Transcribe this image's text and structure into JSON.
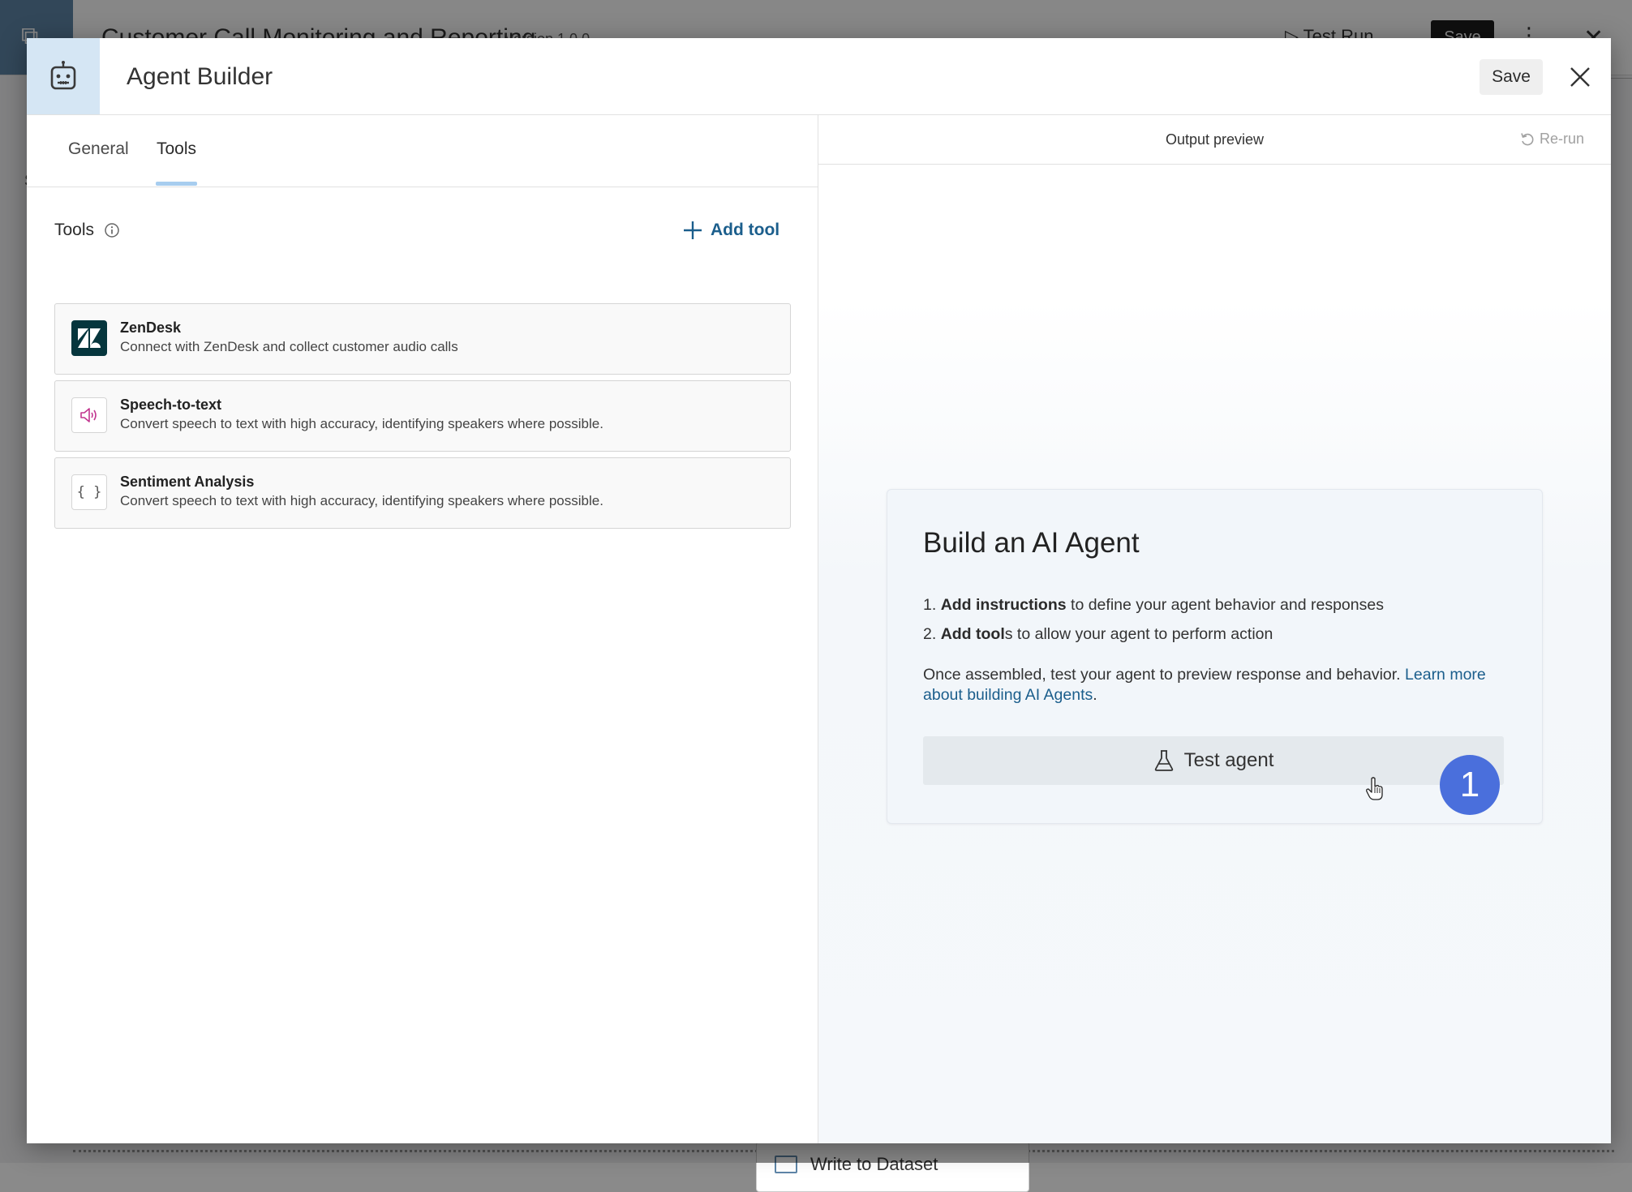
{
  "background_app": {
    "title": "Customer Call Monitoring and Reporting",
    "version": "Version 1.0.0",
    "test_run_label": "Test Run",
    "save_label": "Save",
    "side_letter": "S",
    "dataset_node_label": "Write to Dataset"
  },
  "modal": {
    "title": "Agent Builder",
    "save_label": "Save"
  },
  "tabs": [
    {
      "label": "General",
      "active": false
    },
    {
      "label": "Tools",
      "active": true
    }
  ],
  "tools": {
    "heading": "Tools",
    "add_label": "Add tool",
    "items": [
      {
        "name": "ZenDesk",
        "description": "Connect with ZenDesk and collect customer audio calls",
        "icon": "zendesk-logo-icon"
      },
      {
        "name": "Speech-to-text",
        "description": "Convert speech to text with high accuracy, identifying speakers where possible.",
        "icon": "speaker-icon"
      },
      {
        "name": "Sentiment Analysis",
        "description": "Convert speech to text with high accuracy, identifying speakers where possible.",
        "icon": "braces-icon",
        "icon_text": "{ }"
      }
    ]
  },
  "preview": {
    "title": "Output preview",
    "rerun_label": "Re-run",
    "card": {
      "title": "Build an AI Agent",
      "steps": [
        {
          "number": "1.",
          "bold": "Add instructions",
          "rest": " to define your agent behavior and responses"
        },
        {
          "number": "2.",
          "bold": "Add tool",
          "rest": "s to allow your agent to perform action"
        }
      ],
      "body": "Once assembled, test your agent to preview response and behavior. ",
      "link_text": "Learn more about building AI Agents",
      "body_end": ".",
      "button_label": "Test agent"
    }
  },
  "annotation": {
    "badge_number": "1"
  },
  "colors": {
    "accent_link": "#1b5e8c",
    "tab_underline": "#a7cdef",
    "header_icon_bg": "#d5e6f4",
    "badge": "#4a6fdc",
    "zendesk_tile": "#06363d",
    "speaker_icon": "#c2368f"
  }
}
